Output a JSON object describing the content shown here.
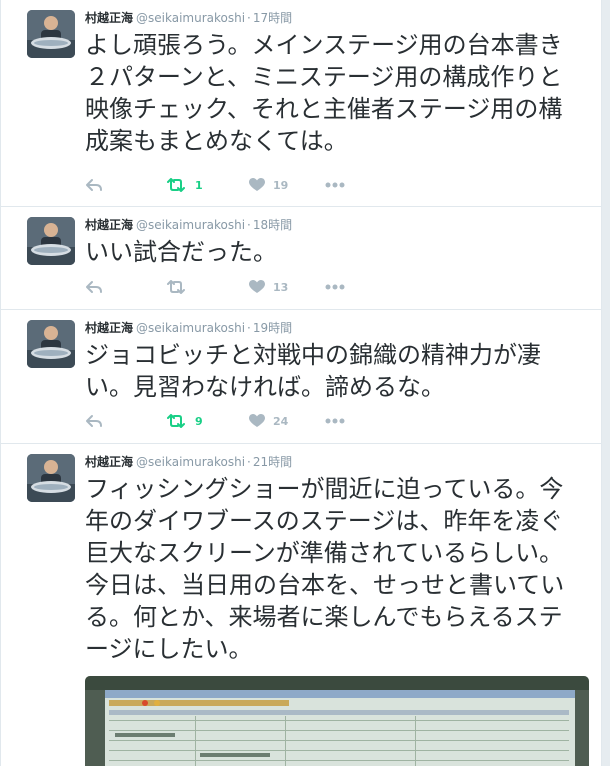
{
  "colors": {
    "retweet_active": "#19cf86",
    "muted": "#aab8c2",
    "text": "#292f33",
    "secondary": "#8899a6"
  },
  "icons": {
    "reply": "reply-icon",
    "retweet": "retweet-icon",
    "like": "heart-icon",
    "more": "more-icon"
  },
  "tweets": [
    {
      "name": "村越正海",
      "handle": "@seikaimurakoshi",
      "separator": "·",
      "time": "17時間",
      "text": "よし頑張ろう。メインステージ用の台本書き２パターンと、ミニステージ用の構成作りと映像チェック、それと主催者ステージ用の構成案もまとめなくては。",
      "retweets": "1",
      "likes": "19",
      "retweet_active": true
    },
    {
      "name": "村越正海",
      "handle": "@seikaimurakoshi",
      "separator": "·",
      "time": "18時間",
      "text": "いい試合だった。",
      "retweets": "",
      "likes": "13",
      "retweet_active": false
    },
    {
      "name": "村越正海",
      "handle": "@seikaimurakoshi",
      "separator": "·",
      "time": "19時間",
      "text": "ジョコビッチと対戦中の錦織の精神力が凄い。見習わなければ。諦めるな。",
      "retweets": "9",
      "likes": "24",
      "retweet_active": true
    },
    {
      "name": "村越正海",
      "handle": "@seikaimurakoshi",
      "separator": "·",
      "time": "21時間",
      "text": "フィッシングショーが間近に迫っている。今年のダイワブースのステージは、昨年を凌ぐ巨大なスクリーンが準備されているらしい。今日は、当日用の台本を、せっせと書いている。何とか、来場者に楽しんでもらえるステージにしたい。",
      "retweets": "",
      "likes": "",
      "retweet_active": false
    }
  ]
}
